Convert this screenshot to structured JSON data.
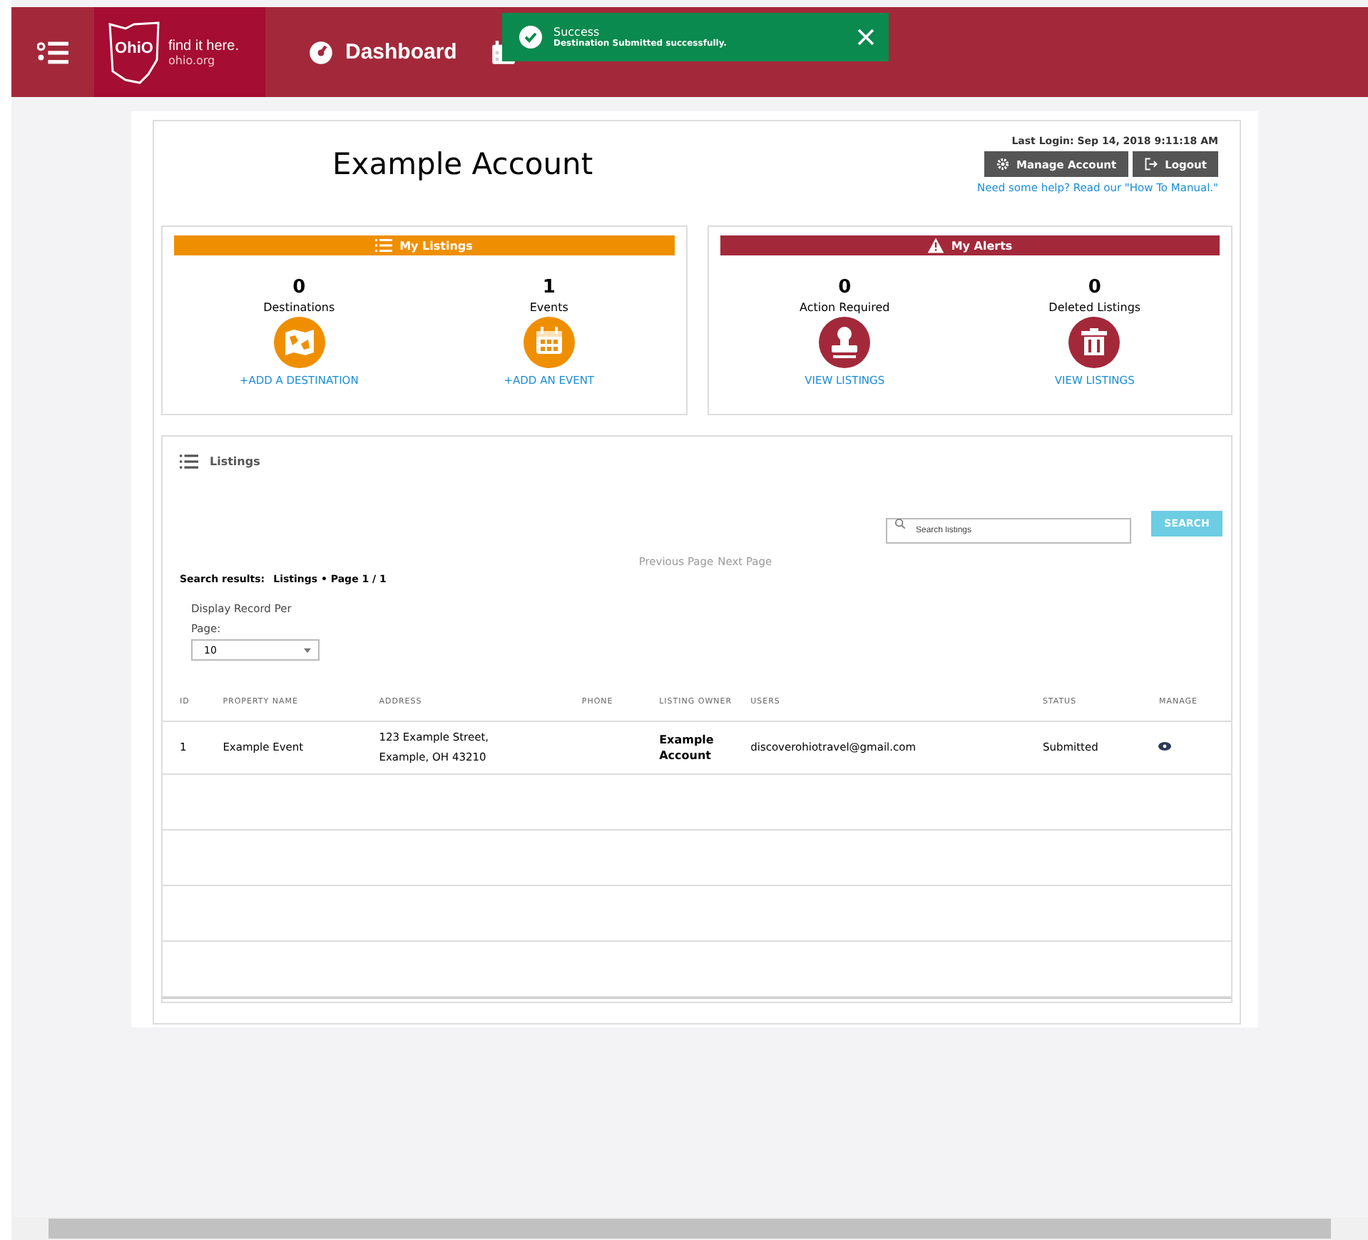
{
  "nav": {
    "logo": {
      "wordmark": "OhiO",
      "tagline": "find it here.",
      "url": "ohio.org"
    },
    "items": [
      {
        "label": "Dashboard",
        "kind": "gauge"
      },
      {
        "kind": "calendar"
      }
    ]
  },
  "toast": {
    "title": "Success",
    "message": "Destination Submitted successfully."
  },
  "account": {
    "name": "Example Account",
    "last_login": "Last Login: Sep 14, 2018 9:11:18 AM",
    "buttons": [
      {
        "label": "Manage Account",
        "kind": "gear"
      },
      {
        "label": "Logout",
        "kind": "exit"
      }
    ],
    "help": "Need some help? Read our \"How To Manual.\""
  },
  "panels": [
    {
      "title": "My Listings",
      "kind": "list",
      "color": "#ef8f00",
      "stats": [
        {
          "count": "0",
          "label": "Destinations",
          "kind": "map",
          "link": "+ADD A DESTINATION"
        },
        {
          "count": "1",
          "label": "Events",
          "kind": "calendar",
          "link": "+ADD AN EVENT"
        }
      ]
    },
    {
      "title": "My Alerts",
      "kind": "warning",
      "color": "#a3293a",
      "stats": [
        {
          "count": "0",
          "label": "Action Required",
          "kind": "stamp",
          "link": "VIEW LISTINGS"
        },
        {
          "count": "0",
          "label": "Deleted Listings",
          "kind": "trash",
          "link": "VIEW LISTINGS"
        }
      ]
    }
  ],
  "listings": {
    "title": "Listings",
    "search": {
      "placeholder": "Search listings"
    },
    "search_button": "SEARCH",
    "pager": [
      {
        "label": "Previous Page",
        "disabled": true
      },
      {
        "label": "Next Page",
        "disabled": true
      }
    ],
    "results_label": "Search results:",
    "results_value": "Listings • Page 1 / 1",
    "per_page_label": "Display Record Per Page:",
    "per_page_value": "10",
    "columns": [
      "ID",
      "PROPERTY NAME",
      "ADDRESS",
      "PHONE",
      "LISTING OWNER",
      "USERS",
      "STATUS",
      "MANAGE"
    ],
    "rows": [
      {
        "id": "1",
        "property": "Example Event",
        "address": [
          "123 Example Street,",
          "Example, OH 43210"
        ],
        "owner": "Example Account",
        "users": "discoverohiotravel@gmail.com",
        "status": "Submitted"
      }
    ]
  }
}
